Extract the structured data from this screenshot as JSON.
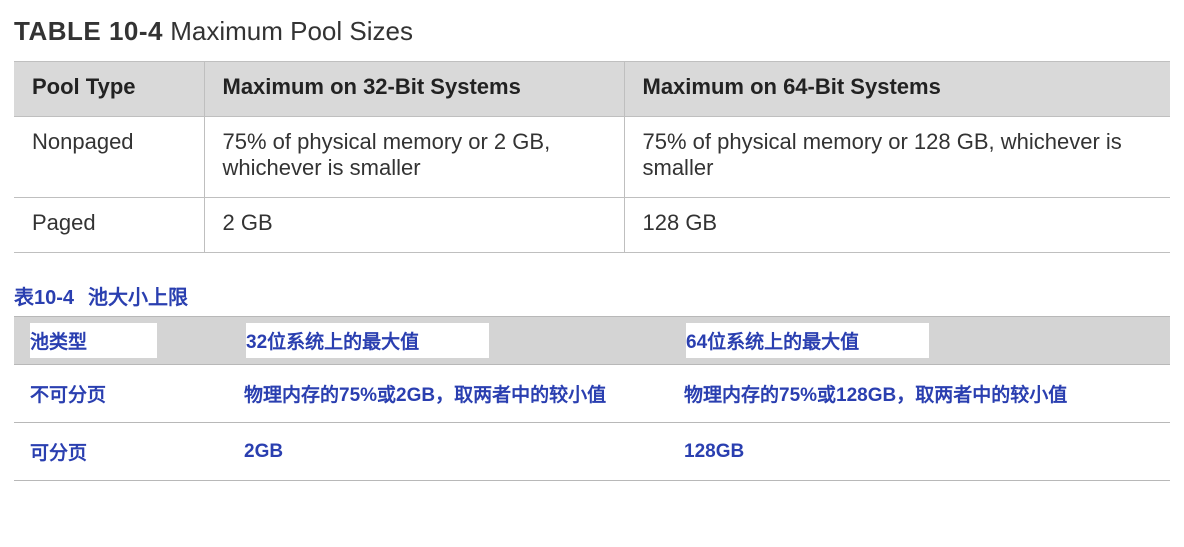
{
  "title_en": {
    "number": "TABLE 10-4",
    "text": "Maximum Pool Sizes"
  },
  "table_en": {
    "headers": [
      "Pool Type",
      "Maximum on 32-Bit Systems",
      "Maximum on 64-Bit Systems"
    ],
    "rows": [
      {
        "type": "Nonpaged",
        "max32": "75% of physical memory or 2 GB, whichever is smaller",
        "max64": "75% of physical memory or 128 GB, whichever is smaller"
      },
      {
        "type": "Paged",
        "max32": "2 GB",
        "max64": "128 GB"
      }
    ]
  },
  "title_zh": {
    "number": "表10-4",
    "text": "池大小上限"
  },
  "table_zh": {
    "headers": [
      "池类型",
      "32位系统上的最大值",
      "64位系统上的最大值"
    ],
    "rows": [
      {
        "type": "不可分页",
        "max32": "物理内存的75%或2GB，取两者中的较小值",
        "max64": "物理内存的75%或128GB，取两者中的较小值"
      },
      {
        "type": "可分页",
        "max32": "2GB",
        "max64": "128GB"
      }
    ]
  }
}
